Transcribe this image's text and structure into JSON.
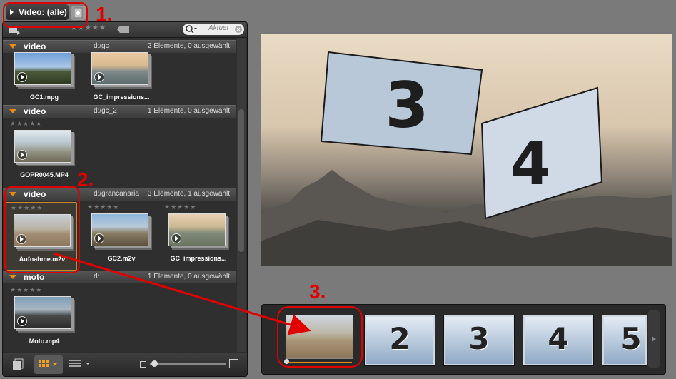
{
  "filter": {
    "label": "Video: (alle)"
  },
  "toolbar": {
    "search_placeholder": "Aktuel",
    "rating_stars": "★★★★★"
  },
  "groups": [
    {
      "name": "video",
      "path": "d:/gc",
      "count": "2 Elemente, 0 ausgewählt",
      "clips": [
        {
          "name": "GC1.mpg",
          "stars": ""
        },
        {
          "name": "GC_impressions...",
          "stars": ""
        }
      ]
    },
    {
      "name": "video",
      "path": "d:/gc_2",
      "count": "1 Elemente, 0 ausgewählt",
      "clips": [
        {
          "name": "GOPR0045.MP4",
          "stars": "★★★★★"
        }
      ]
    },
    {
      "name": "video",
      "path": "d:/grancanaria",
      "count": "3 Elemente, 1 ausgewählt",
      "clips": [
        {
          "name": "Aufnahme.m2v",
          "stars": "★★★★★"
        },
        {
          "name": "GC2.m2v",
          "stars": "★★★★★"
        },
        {
          "name": "GC_impressions...",
          "stars": "★★★★★"
        }
      ]
    },
    {
      "name": "moto",
      "path": "d:",
      "count": "1 Elemente, 0 ausgewählt",
      "clips": [
        {
          "name": "Moto.mp4",
          "stars": "★★★★★"
        }
      ]
    }
  ],
  "preview": {
    "panel_left": "3",
    "panel_right": "4"
  },
  "storyboard": {
    "tiles": [
      "2",
      "3",
      "4",
      "5"
    ]
  },
  "annotations": {
    "a1": "1.",
    "a2": "2.",
    "a3": "3."
  },
  "colors": {
    "accent": "#e88a1a",
    "annotation": "#e00000"
  }
}
